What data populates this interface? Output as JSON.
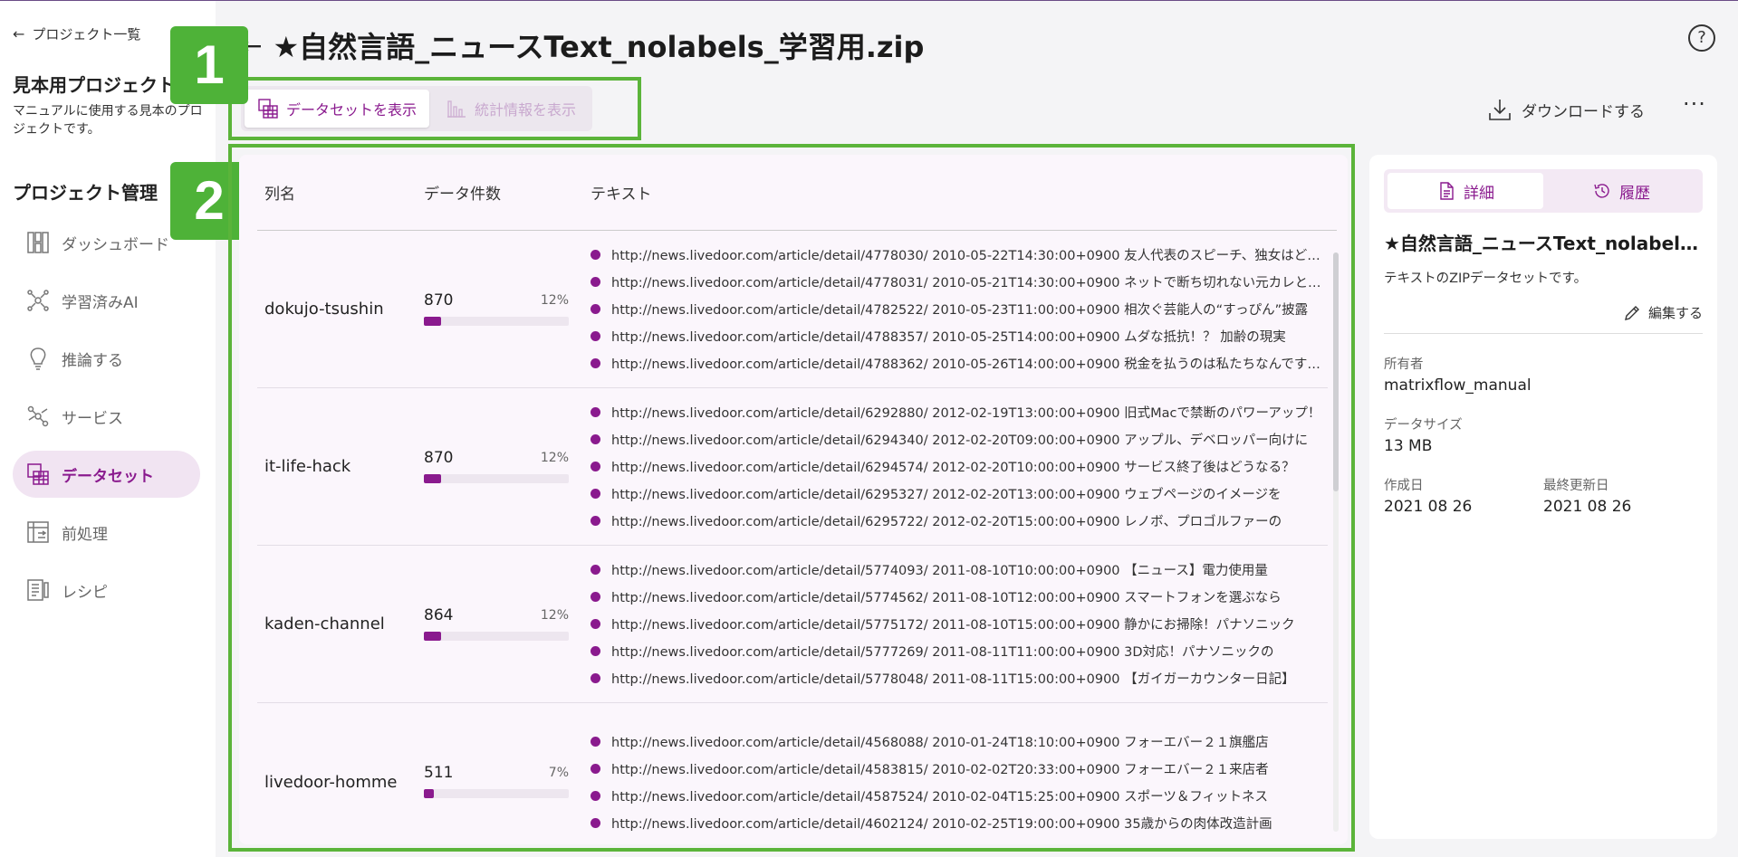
{
  "sidebar": {
    "back_label": "プロジェクト一覧",
    "project_name": "見本用プロジェクト",
    "project_desc": "マニュアルに使用する見本のプロジェクトです。",
    "section_title": "プロジェクト管理",
    "items": [
      {
        "label": "ダッシュボード",
        "icon": "dashboard-icon"
      },
      {
        "label": "学習済みAI",
        "icon": "ai-model-icon"
      },
      {
        "label": "推論する",
        "icon": "lightbulb-icon"
      },
      {
        "label": "サービス",
        "icon": "service-icon"
      },
      {
        "label": "データセット",
        "icon": "dataset-icon",
        "active": true
      },
      {
        "label": "前処理",
        "icon": "preprocess-icon"
      },
      {
        "label": "レシピ",
        "icon": "recipe-icon"
      }
    ]
  },
  "header": {
    "title": "★自然言語_ニュースText_nolabels_学習用.zip",
    "tab_dataset": "データセットを表示",
    "tab_stats": "統計情報を表示",
    "download_label": "ダウンロードする",
    "more_label": "···"
  },
  "badges": {
    "one": "1",
    "two": "2"
  },
  "table": {
    "headers": {
      "col": "列名",
      "count": "データ件数",
      "text": "テキスト"
    },
    "rows": [
      {
        "name": "dokujo-tsushin",
        "count": "870",
        "pct": "12%",
        "fraction": 0.12,
        "texts": [
          "http://news.livedoor.com/article/detail/4778030/ 2010-05-22T14:30:00+0900 友人代表のスピーチ、独女はどうこなしている？",
          "http://news.livedoor.com/article/detail/4778031/ 2010-05-21T14:30:00+0900 ネットで断ち切れない元カレとの縁",
          "http://news.livedoor.com/article/detail/4782522/ 2010-05-23T11:00:00+0900 相次ぐ芸能人の“すっぴん”披露",
          "http://news.livedoor.com/article/detail/4788357/ 2010-05-25T14:00:00+0900 ムダな抵抗！？ 加齢の現実",
          "http://news.livedoor.com/article/detail/4788362/ 2010-05-26T14:00:00+0900 税金を払うのは私たちなんですけど！"
        ]
      },
      {
        "name": "it-life-hack",
        "count": "870",
        "pct": "12%",
        "fraction": 0.12,
        "texts": [
          "http://news.livedoor.com/article/detail/6292880/ 2012-02-19T13:00:00+0900 旧式Macで禁断のパワーアップ！",
          "http://news.livedoor.com/article/detail/6294340/ 2012-02-20T09:00:00+0900 アップル、デベロッパー向けに",
          "http://news.livedoor.com/article/detail/6294574/ 2012-02-20T10:00:00+0900 サービス終了後はどうなる？",
          "http://news.livedoor.com/article/detail/6295327/ 2012-02-20T13:00:00+0900 ウェブページのイメージを",
          "http://news.livedoor.com/article/detail/6295722/ 2012-02-20T15:00:00+0900 レノボ、プロゴルファーの"
        ]
      },
      {
        "name": "kaden-channel",
        "count": "864",
        "pct": "12%",
        "fraction": 0.12,
        "texts": [
          "http://news.livedoor.com/article/detail/5774093/ 2011-08-10T10:00:00+0900 【ニュース】電力使用量",
          "http://news.livedoor.com/article/detail/5774562/ 2011-08-10T12:00:00+0900 スマートフォンを選ぶなら",
          "http://news.livedoor.com/article/detail/5775172/ 2011-08-10T15:00:00+0900 静かにお掃除！パナソニック",
          "http://news.livedoor.com/article/detail/5777269/ 2011-08-11T11:00:00+0900 3D対応！パナソニックの",
          "http://news.livedoor.com/article/detail/5778048/ 2011-08-11T15:00:00+0900 【ガイガーカウンター日記】"
        ]
      },
      {
        "name": "livedoor-homme",
        "count": "511",
        "pct": "7%",
        "fraction": 0.07,
        "texts": [
          "http://news.livedoor.com/article/detail/4568088/ 2010-01-24T18:10:00+0900 フォーエバー２１旗艦店",
          "http://news.livedoor.com/article/detail/4583815/ 2010-02-02T20:33:00+0900 フォーエバー２１来店者",
          "http://news.livedoor.com/article/detail/4587524/ 2010-02-04T15:25:00+0900 スポーツ＆フィットネス",
          "http://news.livedoor.com/article/detail/4602124/ 2010-02-25T19:00:00+0900 35歳からの肉体改造計画"
        ]
      }
    ]
  },
  "detail": {
    "tab_detail": "詳細",
    "tab_history": "履歴",
    "title": "★自然言語_ニュースText_nolabels_学習用.zip",
    "description": "テキストのZIPデータセットです。",
    "edit_label": "編集する",
    "owner_label": "所有者",
    "owner_value": "matrixflow_manual",
    "size_label": "データサイズ",
    "size_value": "13 MB",
    "created_label": "作成日",
    "created_value": "2021 08 26",
    "updated_label": "最終更新日",
    "updated_value": "2021 08 26"
  },
  "colors": {
    "accent": "#8a1a8e",
    "highlight": "#5bb43a"
  }
}
